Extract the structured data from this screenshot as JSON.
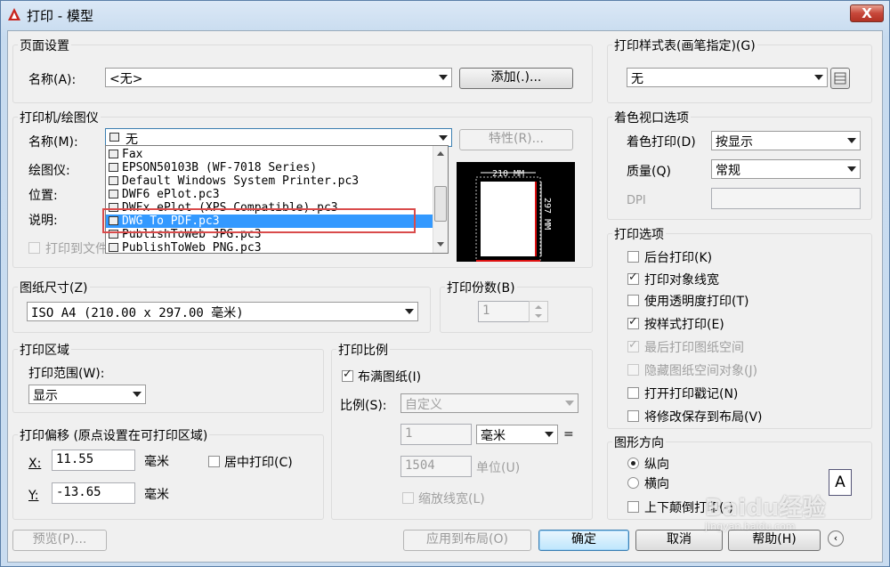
{
  "window": {
    "title": "打印 - 模型",
    "close_label": "X"
  },
  "page_setup": {
    "group_label": "页面设置",
    "name_label": "名称(A):",
    "name_value": "<无>",
    "add_button": "添加(.)..."
  },
  "printer": {
    "group_label": "打印机/绘图仪",
    "name_label": "名称(M):",
    "name_value": "无",
    "properties_button": "特性(R)...",
    "plotter_label": "绘图仪:",
    "location_label": "位置:",
    "description_label": "说明:",
    "print_to_file": "打印到文件",
    "dropdown_items": [
      "Fax",
      "EPSON50103B (WF-7018 Series)",
      "Default Windows System Printer.pc3",
      "DWF6 ePlot.pc3",
      "DWFx ePlot (XPS Compatible).pc3",
      "DWG To PDF.pc3",
      "PublishToWeb JPG.pc3",
      "PublishToWeb PNG.pc3"
    ],
    "selected_index": 5,
    "preview_width": "210 MM",
    "preview_height": "297 MM"
  },
  "paper_size": {
    "group_label": "图纸尺寸(Z)",
    "value": "ISO A4 (210.00 x 297.00 毫米)"
  },
  "copies": {
    "group_label": "打印份数(B)",
    "value": "1"
  },
  "plot_area": {
    "group_label": "打印区域",
    "range_label": "打印范围(W):",
    "range_value": "显示"
  },
  "plot_offset": {
    "group_label": "打印偏移 (原点设置在可打印区域)",
    "x_label": "X:",
    "x_value": "11.55",
    "x_unit": "毫米",
    "y_label": "Y:",
    "y_value": "-13.65",
    "y_unit": "毫米",
    "center_label": "居中打印(C)"
  },
  "plot_scale": {
    "group_label": "打印比例",
    "fit_label": "布满图纸(I)",
    "scale_label": "比例(S):",
    "scale_value": "自定义",
    "value1": "1",
    "unit_value": "毫米",
    "equals": "=",
    "value2": "1504",
    "unit_label": "单位(U)",
    "lineweight_label": "缩放线宽(L)"
  },
  "style_table": {
    "group_label": "打印样式表(画笔指定)(G)",
    "value": "无"
  },
  "shaded_viewport": {
    "group_label": "着色视口选项",
    "shade_label": "着色打印(D)",
    "shade_value": "按显示",
    "quality_label": "质量(Q)",
    "quality_value": "常规",
    "dpi_label": "DPI"
  },
  "plot_options": {
    "group_label": "打印选项",
    "items": [
      {
        "label": "后台打印(K)",
        "checked": false,
        "enabled": true
      },
      {
        "label": "打印对象线宽",
        "checked": true,
        "enabled": true
      },
      {
        "label": "使用透明度打印(T)",
        "checked": false,
        "enabled": true
      },
      {
        "label": "按样式打印(E)",
        "checked": true,
        "enabled": true
      },
      {
        "label": "最后打印图纸空间",
        "checked": true,
        "enabled": false
      },
      {
        "label": "隐藏图纸空间对象(J)",
        "checked": false,
        "enabled": false
      },
      {
        "label": "打开打印戳记(N)",
        "checked": false,
        "enabled": true
      },
      {
        "label": "将修改保存到布局(V)",
        "checked": false,
        "enabled": true
      }
    ]
  },
  "orientation": {
    "group_label": "图形方向",
    "portrait": "纵向",
    "landscape": "横向",
    "upside_down": "上下颠倒打印(-)",
    "icon_letter": "A"
  },
  "footer": {
    "preview": "预览(P)...",
    "apply": "应用到布局(O)",
    "ok": "确定",
    "cancel": "取消",
    "help": "帮助(H)"
  },
  "watermark": {
    "text": "Baidu经验",
    "sub": "jingyan.baidu.com"
  }
}
